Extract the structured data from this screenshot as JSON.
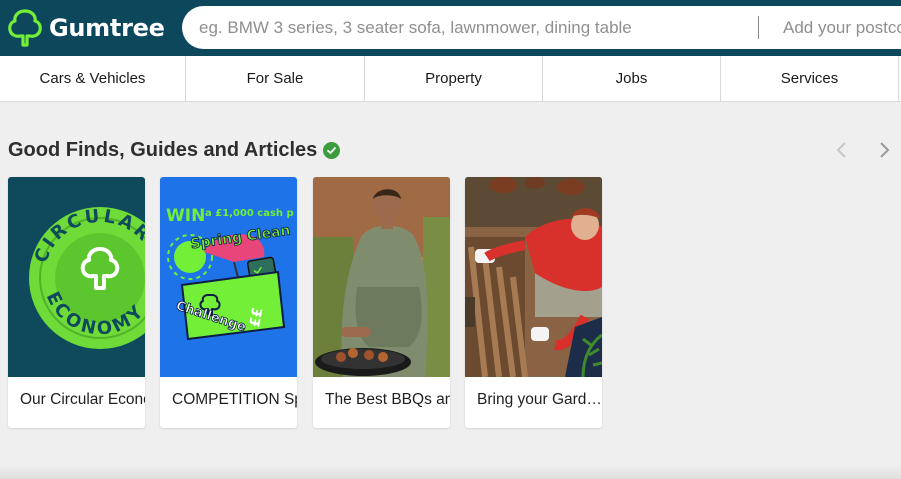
{
  "header": {
    "logo_text": "Gumtree",
    "search_placeholder": "eg. BMW 3 series, 3 seater sofa, lawnmower, dining table",
    "postcode_placeholder": "Add your postcode"
  },
  "nav": {
    "items": [
      {
        "label": "Cars & Vehicles"
      },
      {
        "label": "For Sale"
      },
      {
        "label": "Property"
      },
      {
        "label": "Jobs"
      },
      {
        "label": "Services"
      }
    ]
  },
  "section": {
    "title": "Good Finds, Guides and Articles"
  },
  "cards": [
    {
      "title": "Our Circular Economy",
      "image_text_top": "CIRCULAR",
      "image_text_bottom": "ECONOMY"
    },
    {
      "title": "COMPETITION Spring Clean Challenge",
      "image_banner": "a £1,000 cash p",
      "image_win": "WIN",
      "image_line1": "Spring Clean",
      "image_line2": "Challenge",
      "image_money": "££"
    },
    {
      "title": "The Best BBQs and Grills"
    },
    {
      "title": "Bring your Garden to Life"
    }
  ],
  "colors": {
    "header_bg": "#0d475c",
    "brand_green": "#72ef36",
    "verified_green": "#3c9c3e"
  }
}
